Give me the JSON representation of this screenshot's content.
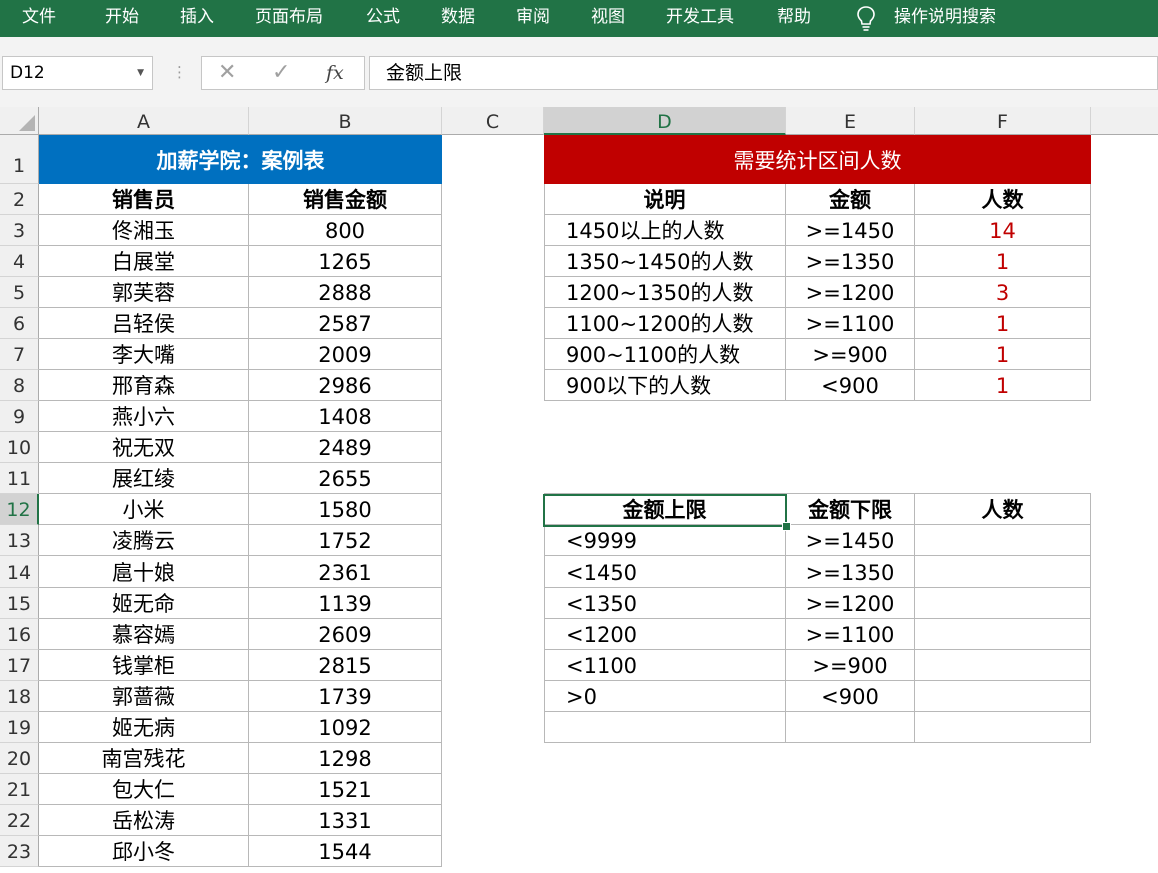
{
  "ribbon": {
    "tabs": [
      "文件",
      "开始",
      "插入",
      "页面布局",
      "公式",
      "数据",
      "审阅",
      "视图",
      "开发工具",
      "帮助"
    ],
    "tell_me": "操作说明搜索"
  },
  "formula_bar": {
    "name_box": "D12",
    "formula": "金额上限"
  },
  "columns": [
    "A",
    "B",
    "C",
    "D",
    "E",
    "F"
  ],
  "rows": [
    "1",
    "2",
    "3",
    "4",
    "5",
    "6",
    "7",
    "8",
    "9",
    "10",
    "11",
    "12",
    "13",
    "14",
    "15",
    "16",
    "17",
    "18",
    "19",
    "20",
    "21",
    "22",
    "23"
  ],
  "selected": {
    "column": "D",
    "row": "12"
  },
  "left_table": {
    "title": "加薪学院：案例表",
    "headers": [
      "销售员",
      "销售金额"
    ],
    "rows": [
      [
        "佟湘玉",
        "800"
      ],
      [
        "白展堂",
        "1265"
      ],
      [
        "郭芙蓉",
        "2888"
      ],
      [
        "吕轻侯",
        "2587"
      ],
      [
        "李大嘴",
        "2009"
      ],
      [
        "邢育森",
        "2986"
      ],
      [
        "燕小六",
        "1408"
      ],
      [
        "祝无双",
        "2489"
      ],
      [
        "展红绫",
        "2655"
      ],
      [
        "小米",
        "1580"
      ],
      [
        "凌腾云",
        "1752"
      ],
      [
        "扈十娘",
        "2361"
      ],
      [
        "姬无命",
        "1139"
      ],
      [
        "慕容嫣",
        "2609"
      ],
      [
        "钱掌柜",
        "2815"
      ],
      [
        "郭蔷薇",
        "1739"
      ],
      [
        "姬无病",
        "1092"
      ],
      [
        "南宫残花",
        "1298"
      ],
      [
        "包大仁",
        "1521"
      ],
      [
        "岳松涛",
        "1331"
      ],
      [
        "邱小冬",
        "1544"
      ]
    ]
  },
  "stats_table": {
    "title": "需要统计区间人数",
    "headers": [
      "说明",
      "金额",
      "人数"
    ],
    "rows": [
      [
        "1450以上的人数",
        ">=1450",
        "14"
      ],
      [
        "1350~1450的人数",
        ">=1350",
        "1"
      ],
      [
        "1200~1350的人数",
        ">=1200",
        "3"
      ],
      [
        "1100~1200的人数",
        ">=1100",
        "1"
      ],
      [
        "900~1100的人数",
        ">=900",
        "1"
      ],
      [
        "900以下的人数",
        "<900",
        "1"
      ]
    ]
  },
  "range_table": {
    "headers": [
      "金额上限",
      "金额下限",
      "人数"
    ],
    "rows": [
      [
        "<9999",
        ">=1450",
        ""
      ],
      [
        "<1450",
        ">=1350",
        ""
      ],
      [
        "<1350",
        ">=1200",
        ""
      ],
      [
        "<1200",
        ">=1100",
        ""
      ],
      [
        "<1100",
        ">=900",
        ""
      ],
      [
        ">0",
        "<900",
        ""
      ],
      [
        "",
        "",
        ""
      ]
    ]
  },
  "colors": {
    "ribbon": "#217346",
    "left_title_fill": "#0070c0",
    "right_title_fill": "#c00000",
    "count_text": "#c00000"
  }
}
